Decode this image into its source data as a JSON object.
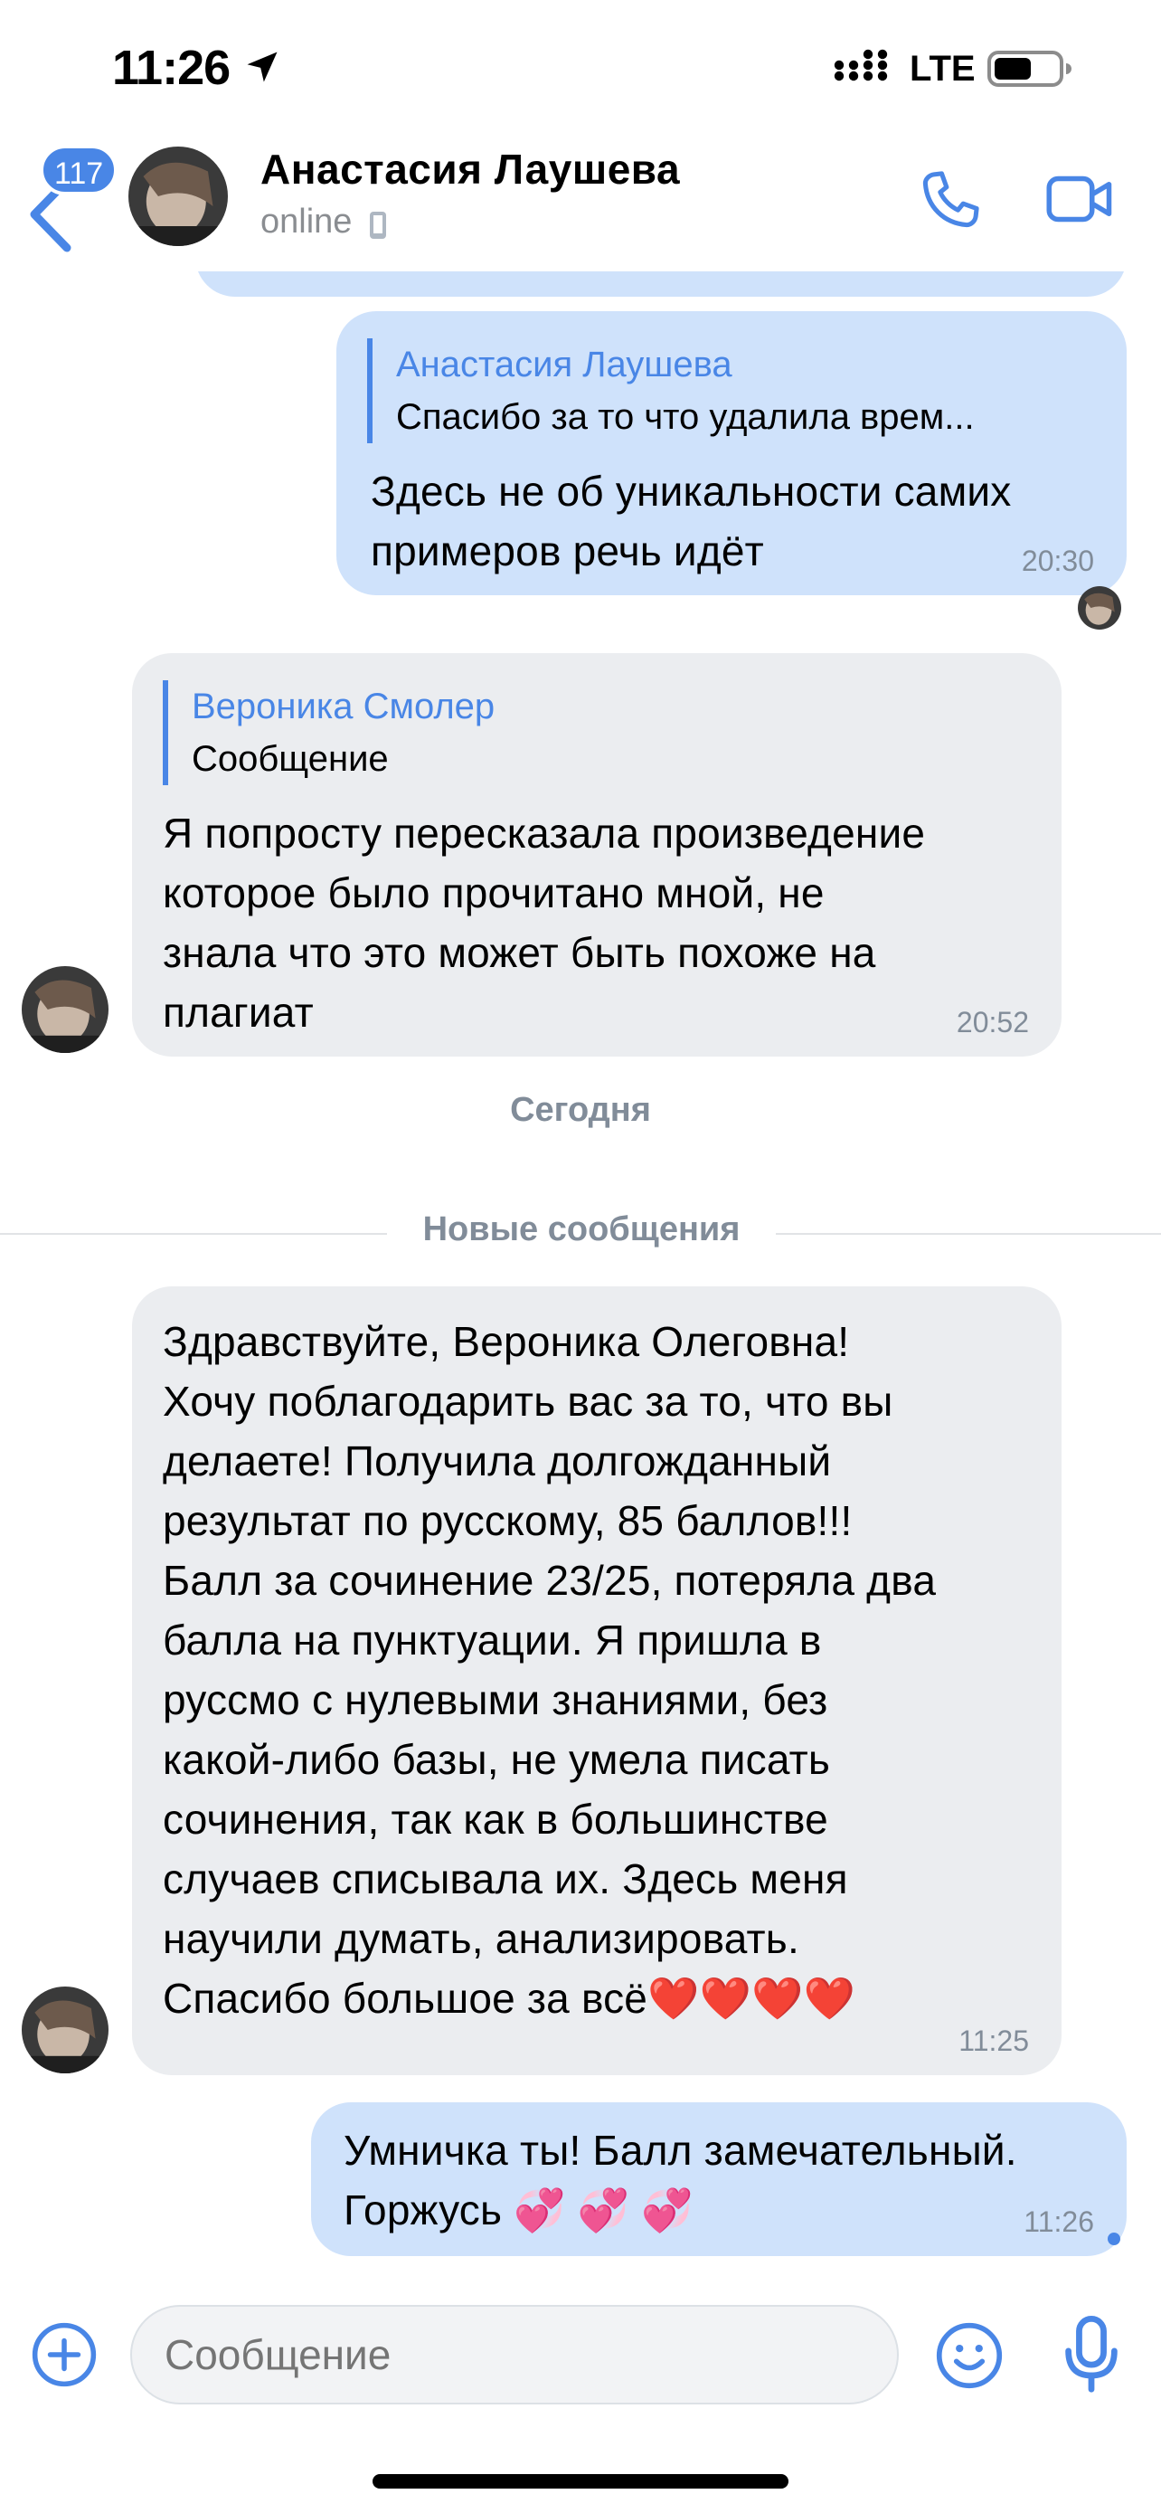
{
  "status_bar": {
    "time": "11:26",
    "network": "LTE"
  },
  "header": {
    "back_badge": "117",
    "contact_name": "Анастасия Лаушева",
    "contact_status": "online",
    "icons": [
      "back-arrow-icon",
      "phone-call-icon",
      "video-call-icon"
    ],
    "accent_color": "#4986e6"
  },
  "messages": [
    {
      "direction": "out",
      "reply_to": {
        "name": "Анастасия Лаушева",
        "text": "Спасибо за то что удалила врем..."
      },
      "lines": [
        "Здесь не об уникальности самих",
        "примеров речь идёт"
      ],
      "time": "20:30"
    },
    {
      "direction": "in",
      "reply_to": {
        "name": "Вероника Смолер",
        "text": "Сообщение"
      },
      "lines": [
        "Я попросту пересказала произведение",
        "которое было прочитано мной, не",
        "знала что это может быть похоже на",
        "плагиат"
      ],
      "time": "20:52"
    },
    {
      "direction": "in",
      "lines": [
        "Здравствуйте, Вероника Олеговна!",
        "Хочу поблагодарить вас за то, что вы",
        "делаете! Получила долгожданный",
        "результат по русскому, 85 баллов!!!",
        "Балл за сочинение 23/25, потеряла два",
        "балла на пунктуации. Я пришла в",
        "руссмо с нулевыми знаниями, без",
        "какой-либо базы, не умела писать",
        "сочинения, так как в большинстве",
        "случаев списывала их. Здесь меня",
        "научили думать, анализировать.",
        "Спасибо большое за всё❤️❤️❤️❤️"
      ],
      "time": "11:25"
    },
    {
      "direction": "out",
      "lines": [
        "Умничка ты! Балл замечательный.",
        "Горжусь 💞 💞 💞"
      ],
      "time": "11:26"
    }
  ],
  "separators": {
    "date": "Сегодня",
    "new_messages": "Новые сообщения"
  },
  "composer": {
    "placeholder": "Сообщение",
    "icons": [
      "plus-icon",
      "smile-icon",
      "microphone-icon"
    ]
  },
  "colors": {
    "outgoing_bubble": "#cfe2fb",
    "incoming_bubble": "#ebedf0",
    "link_blue": "#4986e6",
    "meta_gray": "#818c99"
  }
}
